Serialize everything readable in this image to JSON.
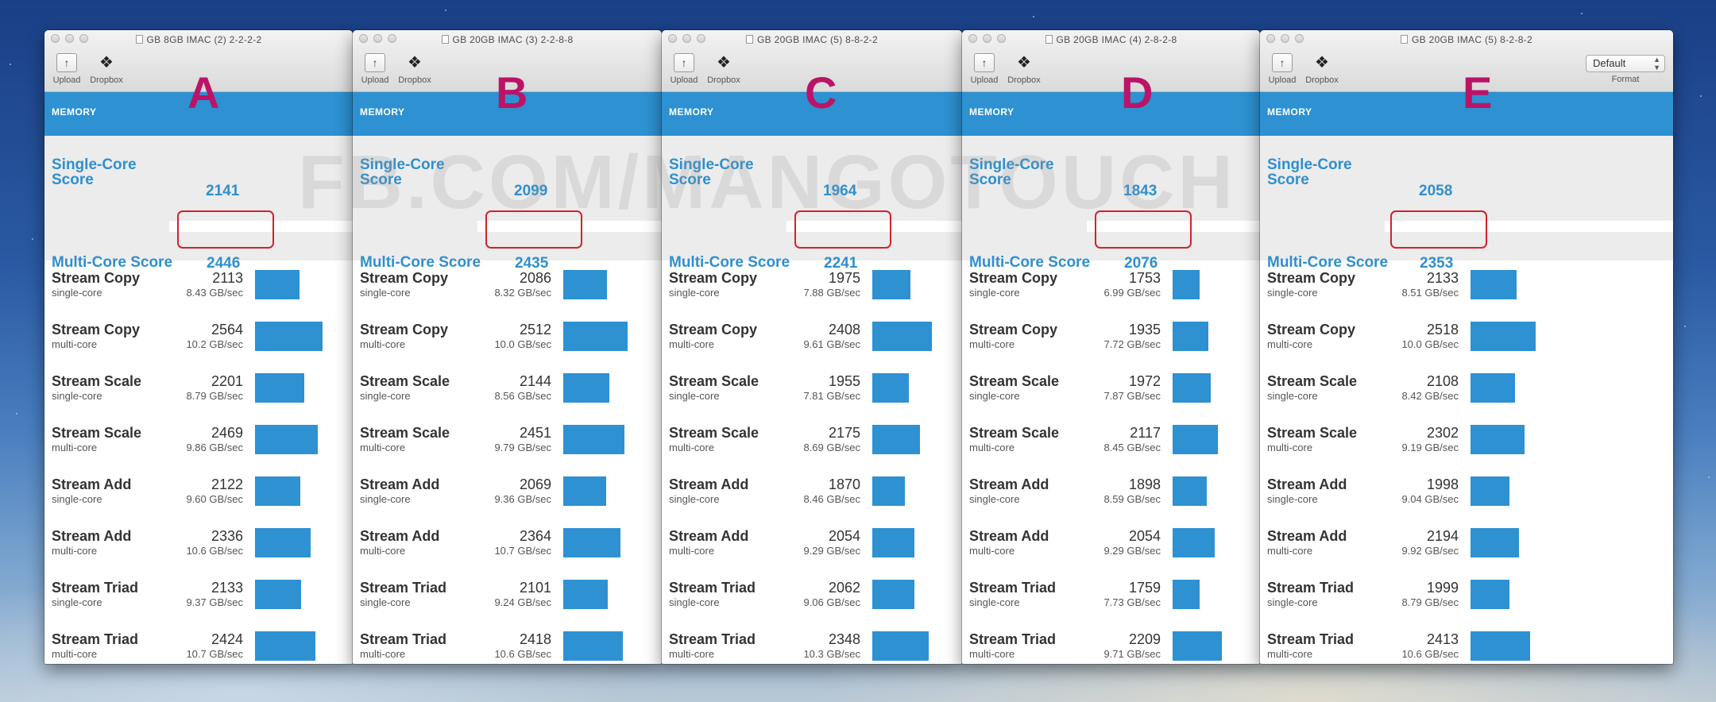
{
  "watermark": "FB.COM/MANGOTOUCH",
  "accent_color": "#2d91d2",
  "letter_color": "#bb1466",
  "highlight_color": "#d2232a",
  "toolbar": {
    "upload_label": "Upload",
    "dropbox_label": "Dropbox",
    "format_label": "Format",
    "format_value": "Default"
  },
  "section_label": "MEMORY",
  "single_core_label": "Single-Core Score",
  "single_core_line1": "Single-Core",
  "single_core_line2": "Score",
  "multi_core_label": "Multi-Core Score",
  "windows": [
    {
      "letter": "A",
      "title": "GB 8GB IMAC (2) 2-2-2-2",
      "single_core": "2141",
      "multi_core": "2446",
      "rows": [
        {
          "name": "Stream Copy",
          "mode": "single-core",
          "score": "2113",
          "bw": "8.43 GB/sec"
        },
        {
          "name": "Stream Copy",
          "mode": "multi-core",
          "score": "2564",
          "bw": "10.2 GB/sec"
        },
        {
          "name": "Stream Scale",
          "mode": "single-core",
          "score": "2201",
          "bw": "8.79 GB/sec"
        },
        {
          "name": "Stream Scale",
          "mode": "multi-core",
          "score": "2469",
          "bw": "9.86 GB/sec"
        },
        {
          "name": "Stream Add",
          "mode": "single-core",
          "score": "2122",
          "bw": "9.60 GB/sec"
        },
        {
          "name": "Stream Add",
          "mode": "multi-core",
          "score": "2336",
          "bw": "10.6 GB/sec"
        },
        {
          "name": "Stream Triad",
          "mode": "single-core",
          "score": "2133",
          "bw": "9.37 GB/sec"
        },
        {
          "name": "Stream Triad",
          "mode": "multi-core",
          "score": "2424",
          "bw": "10.7 GB/sec"
        }
      ]
    },
    {
      "letter": "B",
      "title": "GB 20GB IMAC (3) 2-2-8-8",
      "single_core": "2099",
      "multi_core": "2435",
      "rows": [
        {
          "name": "Stream Copy",
          "mode": "single-core",
          "score": "2086",
          "bw": "8.32 GB/sec"
        },
        {
          "name": "Stream Copy",
          "mode": "multi-core",
          "score": "2512",
          "bw": "10.0 GB/sec"
        },
        {
          "name": "Stream Scale",
          "mode": "single-core",
          "score": "2144",
          "bw": "8.56 GB/sec"
        },
        {
          "name": "Stream Scale",
          "mode": "multi-core",
          "score": "2451",
          "bw": "9.79 GB/sec"
        },
        {
          "name": "Stream Add",
          "mode": "single-core",
          "score": "2069",
          "bw": "9.36 GB/sec"
        },
        {
          "name": "Stream Add",
          "mode": "multi-core",
          "score": "2364",
          "bw": "10.7 GB/sec"
        },
        {
          "name": "Stream Triad",
          "mode": "single-core",
          "score": "2101",
          "bw": "9.24 GB/sec"
        },
        {
          "name": "Stream Triad",
          "mode": "multi-core",
          "score": "2418",
          "bw": "10.6 GB/sec"
        }
      ]
    },
    {
      "letter": "C",
      "title": "GB 20GB IMAC (5) 8-8-2-2",
      "single_core": "1964",
      "multi_core": "2241",
      "rows": [
        {
          "name": "Stream Copy",
          "mode": "single-core",
          "score": "1975",
          "bw": "7.88 GB/sec"
        },
        {
          "name": "Stream Copy",
          "mode": "multi-core",
          "score": "2408",
          "bw": "9.61 GB/sec"
        },
        {
          "name": "Stream Scale",
          "mode": "single-core",
          "score": "1955",
          "bw": "7.81 GB/sec"
        },
        {
          "name": "Stream Scale",
          "mode": "multi-core",
          "score": "2175",
          "bw": "8.69 GB/sec"
        },
        {
          "name": "Stream Add",
          "mode": "single-core",
          "score": "1870",
          "bw": "8.46 GB/sec"
        },
        {
          "name": "Stream Add",
          "mode": "multi-core",
          "score": "2054",
          "bw": "9.29 GB/sec"
        },
        {
          "name": "Stream Triad",
          "mode": "single-core",
          "score": "2062",
          "bw": "9.06 GB/sec"
        },
        {
          "name": "Stream Triad",
          "mode": "multi-core",
          "score": "2348",
          "bw": "10.3 GB/sec"
        }
      ]
    },
    {
      "letter": "D",
      "title": "GB 20GB IMAC (4) 2-8-2-8",
      "single_core": "1843",
      "multi_core": "2076",
      "rows": [
        {
          "name": "Stream Copy",
          "mode": "single-core",
          "score": "1753",
          "bw": "6.99 GB/sec"
        },
        {
          "name": "Stream Copy",
          "mode": "multi-core",
          "score": "1935",
          "bw": "7.72 GB/sec"
        },
        {
          "name": "Stream Scale",
          "mode": "single-core",
          "score": "1972",
          "bw": "7.87 GB/sec"
        },
        {
          "name": "Stream Scale",
          "mode": "multi-core",
          "score": "2117",
          "bw": "8.45 GB/sec"
        },
        {
          "name": "Stream Add",
          "mode": "single-core",
          "score": "1898",
          "bw": "8.59 GB/sec"
        },
        {
          "name": "Stream Add",
          "mode": "multi-core",
          "score": "2054",
          "bw": "9.29 GB/sec"
        },
        {
          "name": "Stream Triad",
          "mode": "single-core",
          "score": "1759",
          "bw": "7.73 GB/sec"
        },
        {
          "name": "Stream Triad",
          "mode": "multi-core",
          "score": "2209",
          "bw": "9.71 GB/sec"
        }
      ]
    },
    {
      "letter": "E",
      "title": "GB 20GB IMAC (5) 8-2-8-2",
      "single_core": "2058",
      "multi_core": "2353",
      "rows": [
        {
          "name": "Stream Copy",
          "mode": "single-core",
          "score": "2133",
          "bw": "8.51 GB/sec"
        },
        {
          "name": "Stream Copy",
          "mode": "multi-core",
          "score": "2518",
          "bw": "10.0 GB/sec"
        },
        {
          "name": "Stream Scale",
          "mode": "single-core",
          "score": "2108",
          "bw": "8.42 GB/sec"
        },
        {
          "name": "Stream Scale",
          "mode": "multi-core",
          "score": "2302",
          "bw": "9.19 GB/sec"
        },
        {
          "name": "Stream Add",
          "mode": "single-core",
          "score": "1998",
          "bw": "9.04 GB/sec"
        },
        {
          "name": "Stream Add",
          "mode": "multi-core",
          "score": "2194",
          "bw": "9.92 GB/sec"
        },
        {
          "name": "Stream Triad",
          "mode": "single-core",
          "score": "1999",
          "bw": "8.79 GB/sec"
        },
        {
          "name": "Stream Triad",
          "mode": "multi-core",
          "score": "2413",
          "bw": "10.6 GB/sec"
        }
      ]
    }
  ]
}
